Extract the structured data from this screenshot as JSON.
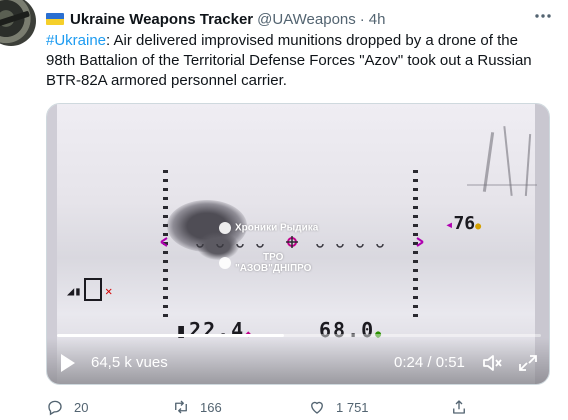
{
  "author": {
    "name": "Ukraine Weapons Tracker",
    "handle": "@UAWeapons",
    "separator": "·",
    "time": "4h",
    "flag_colors": [
      "#2a6fd1",
      "#f5cf2a"
    ]
  },
  "more_icon": "ellipsis-icon",
  "tweet": {
    "hashtag": "#Ukraine",
    "text": ": Air delivered improvised munitions dropped by a drone of the 98th Battalion of the Territorial Defense Forces \"Azov\" took out a Russian BTR-82A armored personnel carrier."
  },
  "video": {
    "hud_top_right": "76",
    "hud_bottom_left": "22.4",
    "hud_bottom_mid": "68.0",
    "watermark_line1": "Хроники Рыдика",
    "watermark_line2": "ТРО",
    "watermark_line3": "\"АЗОВ\"ДНІПРО",
    "views": "64,5 k vues",
    "time": "0:24 / 0:51",
    "progress": 0.47,
    "play_icon": "play-icon",
    "mute_icon": "speaker-mute-icon",
    "expand_icon": "expand-icon"
  },
  "actions": {
    "replies": "20",
    "retweets": "166",
    "likes": "1 751"
  },
  "colors": {
    "link": "#1d9bf0",
    "secondary_text": "#536471",
    "text": "#0f1419"
  }
}
